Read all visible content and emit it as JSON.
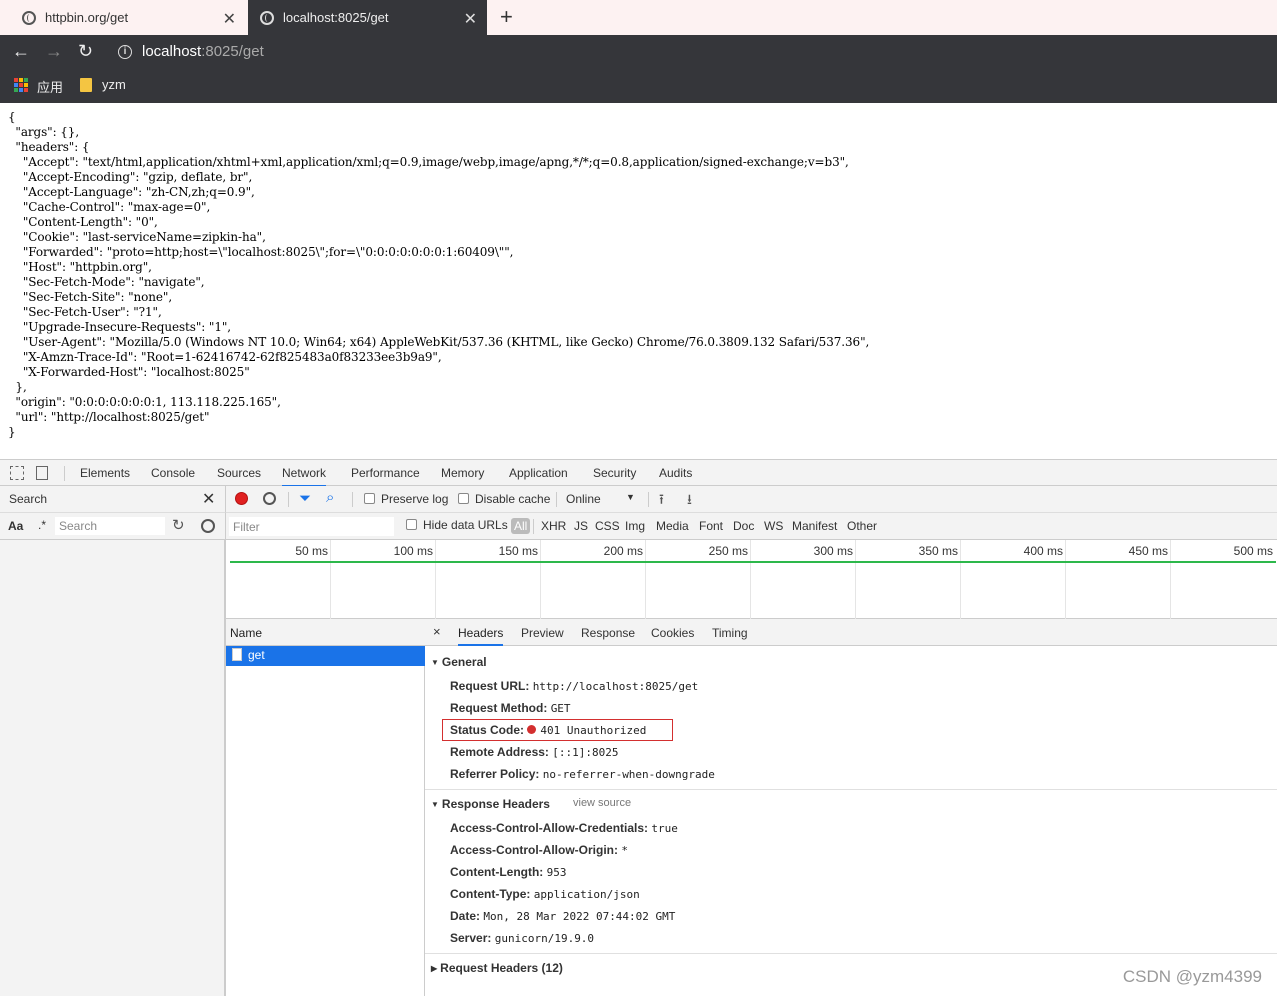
{
  "browser": {
    "tabs": [
      {
        "title": "httpbin.org/get",
        "active": false
      },
      {
        "title": "localhost:8025/get",
        "active": true
      }
    ],
    "new_tab": "+",
    "url_host": "localhost",
    "url_rest": ":8025/get",
    "bookmarks": [
      "应用",
      "yzm"
    ]
  },
  "page": {
    "json_text": "{\n  \"args\": {},\n  \"headers\": {\n    \"Accept\": \"text/html,application/xhtml+xml,application/xml;q=0.9,image/webp,image/apng,*/*;q=0.8,application/signed-exchange;v=b3\",\n    \"Accept-Encoding\": \"gzip, deflate, br\",\n    \"Accept-Language\": \"zh-CN,zh;q=0.9\",\n    \"Cache-Control\": \"max-age=0\",\n    \"Content-Length\": \"0\",\n    \"Cookie\": \"last-serviceName=zipkin-ha\",\n    \"Forwarded\": \"proto=http;host=\\\"localhost:8025\\\";for=\\\"0:0:0:0:0:0:0:1:60409\\\"\",\n    \"Host\": \"httpbin.org\",\n    \"Sec-Fetch-Mode\": \"navigate\",\n    \"Sec-Fetch-Site\": \"none\",\n    \"Sec-Fetch-User\": \"?1\",\n    \"Upgrade-Insecure-Requests\": \"1\",\n    \"User-Agent\": \"Mozilla/5.0 (Windows NT 10.0; Win64; x64) AppleWebKit/537.36 (KHTML, like Gecko) Chrome/76.0.3809.132 Safari/537.36\",\n    \"X-Amzn-Trace-Id\": \"Root=1-62416742-62f825483a0f83233ee3b9a9\",\n    \"X-Forwarded-Host\": \"localhost:8025\"\n  },\n  \"origin\": \"0:0:0:0:0:0:0:1, 113.118.225.165\",\n  \"url\": \"http://localhost:8025/get\"\n}"
  },
  "devtools": {
    "tabs": [
      "Elements",
      "Console",
      "Sources",
      "Network",
      "Performance",
      "Memory",
      "Application",
      "Security",
      "Audits"
    ],
    "active_tab": "Network",
    "left_search_label": "Search",
    "left_search_aa": "Aa",
    "left_search_regex": ".*",
    "left_search_placeholder": "Search",
    "network_toolbar": {
      "preserve_log": "Preserve log",
      "disable_cache": "Disable cache",
      "throttle": "Online"
    },
    "filter": {
      "placeholder": "Filter",
      "hide_data_urls": "Hide data URLs",
      "types": [
        "All",
        "XHR",
        "JS",
        "CSS",
        "Img",
        "Media",
        "Font",
        "Doc",
        "WS",
        "Manifest",
        "Other"
      ]
    },
    "timeline_ticks": [
      "50 ms",
      "100 ms",
      "150 ms",
      "200 ms",
      "250 ms",
      "300 ms",
      "350 ms",
      "400 ms",
      "450 ms",
      "500 ms"
    ],
    "name_header": "Name",
    "requests": [
      "get"
    ],
    "detail_close": "×",
    "detail_tabs": [
      "Headers",
      "Preview",
      "Response",
      "Cookies",
      "Timing"
    ],
    "general": {
      "title": "General",
      "rows": [
        {
          "k": "Request URL:",
          "v": "http://localhost:8025/get"
        },
        {
          "k": "Request Method:",
          "v": "GET"
        },
        {
          "k": "Status Code:",
          "v": "401 Unauthorized"
        },
        {
          "k": "Remote Address:",
          "v": "[::1]:8025"
        },
        {
          "k": "Referrer Policy:",
          "v": "no-referrer-when-downgrade"
        }
      ]
    },
    "response_headers": {
      "title": "Response Headers",
      "view_source": "view source",
      "rows": [
        {
          "k": "Access-Control-Allow-Credentials:",
          "v": "true"
        },
        {
          "k": "Access-Control-Allow-Origin:",
          "v": "*"
        },
        {
          "k": "Content-Length:",
          "v": "953"
        },
        {
          "k": "Content-Type:",
          "v": "application/json"
        },
        {
          "k": "Date:",
          "v": "Mon, 28 Mar 2022 07:44:02 GMT"
        },
        {
          "k": "Server:",
          "v": "gunicorn/19.9.0"
        }
      ]
    },
    "request_headers_title": "Request Headers (12)"
  },
  "watermark": "CSDN @yzm4399"
}
